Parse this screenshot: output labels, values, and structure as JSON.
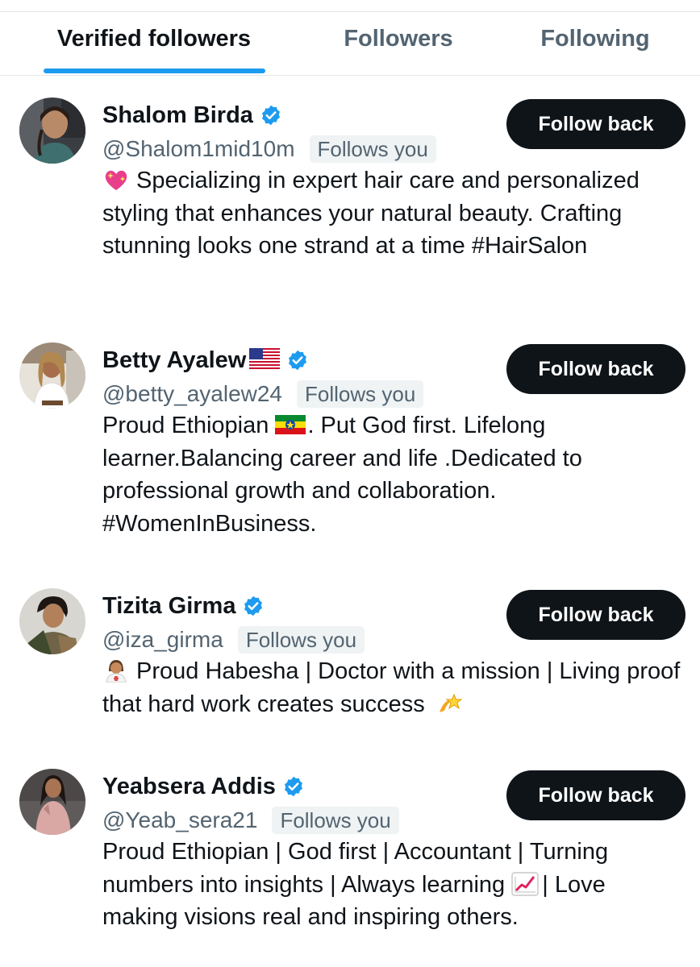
{
  "tabs": [
    {
      "label": "Verified followers",
      "active": true
    },
    {
      "label": "Followers",
      "active": false
    },
    {
      "label": "Following",
      "active": false
    }
  ],
  "colors": {
    "accent": "#1d9bf0",
    "button_bg": "#0f1419",
    "muted": "#536471",
    "badge_bg": "#eff3f4"
  },
  "users": [
    {
      "name": "Shalom Birda",
      "handle": "@Shalom1mid10m",
      "follows_badge": "Follows you",
      "verified": true,
      "button": "Follow back",
      "bio_emoji": "sparkling-heart-emoji",
      "bio": "Specializing in expert hair care and personalized styling that enhances your natural beauty. Crafting stunning looks one strand at a time #HairSalon"
    },
    {
      "name": "Betty Ayalew",
      "name_flag": "us-flag-emoji",
      "handle": "@betty_ayalew24",
      "follows_badge": "Follows you",
      "verified": true,
      "button": "Follow back",
      "bio_part1": "Proud Ethiopian",
      "bio_mid_emoji": "ethiopia-flag-emoji",
      "bio_part2": ". Put God first. Lifelong learner.Balancing career and life .Dedicated to professional growth and collaboration. #WomenInBusiness."
    },
    {
      "name": "Tizita Girma",
      "handle": "@iza_girma",
      "follows_badge": "Follows you",
      "verified": true,
      "button": "Follow back",
      "bio_emoji": "woman-health-worker-emoji",
      "bio": "Proud Habesha | Doctor with a mission | Living proof that hard work creates success",
      "bio_end_emoji": "dizzy-emoji"
    },
    {
      "name": "Yeabsera Addis",
      "handle": "@Yeab_sera21",
      "follows_badge": "Follows you",
      "verified": true,
      "button": "Follow back",
      "bio_part1": "Proud Ethiopian | God first | Accountant | Turning numbers into insights | Always learning",
      "bio_mid_emoji": "chart-increasing-emoji",
      "bio_part2": "| Love making visions real and inspiring others."
    }
  ]
}
